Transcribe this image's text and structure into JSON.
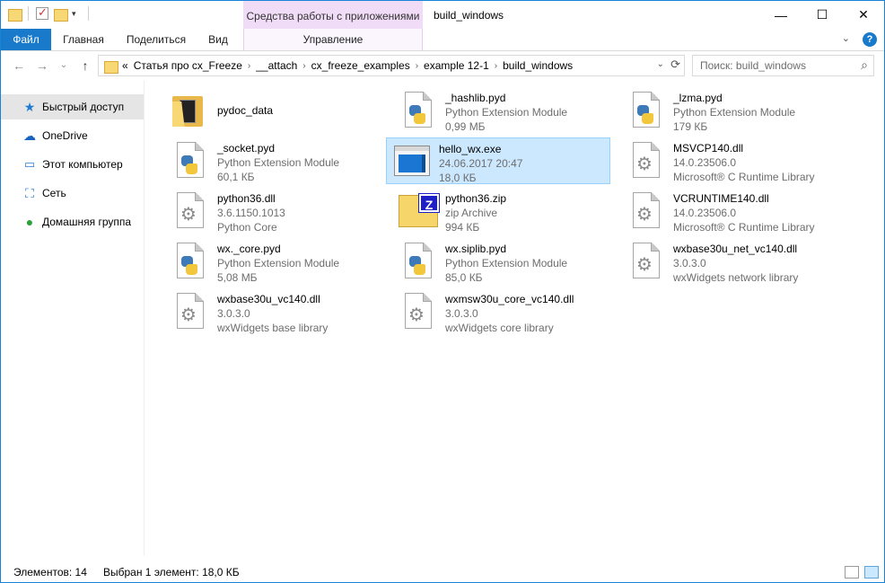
{
  "titlebar": {
    "contextual_tab": "Средства работы с приложениями",
    "window_title": "build_windows",
    "minimize": "—",
    "maximize": "☐",
    "close": "✕"
  },
  "ribbon": {
    "tabs": [
      "Файл",
      "Главная",
      "Поделиться",
      "Вид"
    ],
    "contextual_sub": "Управление"
  },
  "address": {
    "overflow": "«",
    "crumbs": [
      "Статья про cx_Freeze",
      "__attach",
      "cx_freeze_examples",
      "example 12-1",
      "build_windows"
    ],
    "search_placeholder": "Поиск: build_windows"
  },
  "navpane": {
    "items": [
      {
        "label": "Быстрый доступ",
        "icon": "star-icon"
      },
      {
        "label": "OneDrive",
        "icon": "cloud-icon"
      },
      {
        "label": "Этот компьютер",
        "icon": "computer-icon"
      },
      {
        "label": "Сеть",
        "icon": "network-icon"
      },
      {
        "label": "Домашняя группа",
        "icon": "homegroup-icon"
      }
    ]
  },
  "files": [
    {
      "name": "pydoc_data",
      "line2": "",
      "line3": "",
      "icon": "folder"
    },
    {
      "name": "_hashlib.pyd",
      "line2": "Python Extension Module",
      "line3": "0,99 МБ",
      "icon": "python"
    },
    {
      "name": "_lzma.pyd",
      "line2": "Python Extension Module",
      "line3": "179 КБ",
      "icon": "python"
    },
    {
      "name": "_socket.pyd",
      "line2": "Python Extension Module",
      "line3": "60,1 КБ",
      "icon": "python"
    },
    {
      "name": "hello_wx.exe",
      "line2": "24.06.2017 20:47",
      "line3": "18,0 КБ",
      "icon": "exe"
    },
    {
      "name": "MSVCP140.dll",
      "line2": "14.0.23506.0",
      "line3": "Microsoft® C Runtime Library",
      "icon": "dll"
    },
    {
      "name": "python36.dll",
      "line2": "3.6.1150.1013",
      "line3": "Python Core",
      "icon": "dll"
    },
    {
      "name": "python36.zip",
      "line2": "zip Archive",
      "line3": "994 КБ",
      "icon": "zip"
    },
    {
      "name": "VCRUNTIME140.dll",
      "line2": "14.0.23506.0",
      "line3": "Microsoft® C Runtime Library",
      "icon": "dll"
    },
    {
      "name": "wx._core.pyd",
      "line2": "Python Extension Module",
      "line3": "5,08 МБ",
      "icon": "python"
    },
    {
      "name": "wx.siplib.pyd",
      "line2": "Python Extension Module",
      "line3": "85,0 КБ",
      "icon": "python"
    },
    {
      "name": "wxbase30u_net_vc140.dll",
      "line2": "3.0.3.0",
      "line3": "wxWidgets network library",
      "icon": "dll"
    },
    {
      "name": "wxbase30u_vc140.dll",
      "line2": "3.0.3.0",
      "line3": "wxWidgets base library",
      "icon": "dll"
    },
    {
      "name": "wxmsw30u_core_vc140.dll",
      "line2": "3.0.3.0",
      "line3": "wxWidgets core library",
      "icon": "dll"
    }
  ],
  "status": {
    "count": "Элементов: 14",
    "selection": "Выбран 1 элемент: 18,0 КБ"
  },
  "colors": {
    "file_tab": "#1979ca",
    "contextual_tab": "#f0dcf6",
    "selection": "#cce8ff"
  }
}
